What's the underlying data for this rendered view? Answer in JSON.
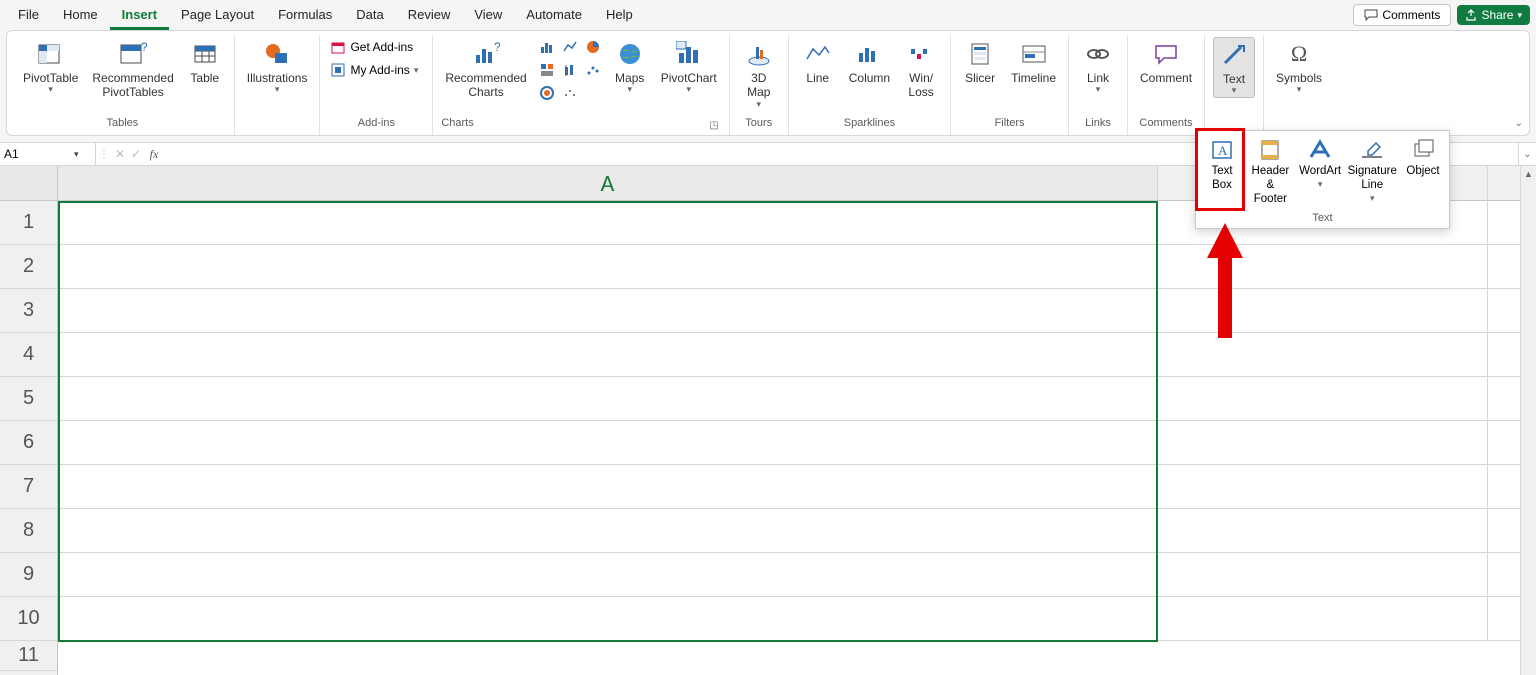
{
  "tabs": [
    "File",
    "Home",
    "Insert",
    "Page Layout",
    "Formulas",
    "Data",
    "Review",
    "View",
    "Automate",
    "Help"
  ],
  "active_tab": "Insert",
  "top_right": {
    "comments": "Comments",
    "share": "Share"
  },
  "ribbon": {
    "tables": {
      "label": "Tables",
      "pivottable": "PivotTable",
      "recommended_pt": "Recommended\nPivotTables",
      "table": "Table"
    },
    "illustrations": {
      "label": "Illustrations",
      "btn": "Illustrations"
    },
    "addins": {
      "label": "Add-ins",
      "get": "Get Add-ins",
      "my": "My Add-ins"
    },
    "charts": {
      "label": "Charts",
      "recommended": "Recommended\nCharts",
      "maps": "Maps",
      "pivotchart": "PivotChart"
    },
    "tours": {
      "label": "Tours",
      "map3d": "3D\nMap"
    },
    "sparklines": {
      "label": "Sparklines",
      "line": "Line",
      "column": "Column",
      "winloss": "Win/\nLoss"
    },
    "filters": {
      "label": "Filters",
      "slicer": "Slicer",
      "timeline": "Timeline"
    },
    "links": {
      "label": "Links",
      "link": "Link"
    },
    "comments": {
      "label": "Comments",
      "comment": "Comment"
    },
    "text": {
      "label": "Text",
      "btn": "Text"
    },
    "symbols": {
      "label": "Symbols",
      "btn": "Symbols"
    }
  },
  "text_panel": {
    "label": "Text",
    "textbox": "Text\nBox",
    "header_footer": "Header\n& Footer",
    "wordart": "WordArt",
    "sigline": "Signature\nLine",
    "object": "Object"
  },
  "formula_bar": {
    "cell_ref": "A1",
    "value": ""
  },
  "grid": {
    "columns": [
      "A"
    ],
    "rows": [
      "1",
      "2",
      "3",
      "4",
      "5",
      "6",
      "7",
      "8",
      "9",
      "10",
      "11"
    ]
  },
  "colors": {
    "accent": "#147a3b",
    "annotation": "#e40000"
  }
}
